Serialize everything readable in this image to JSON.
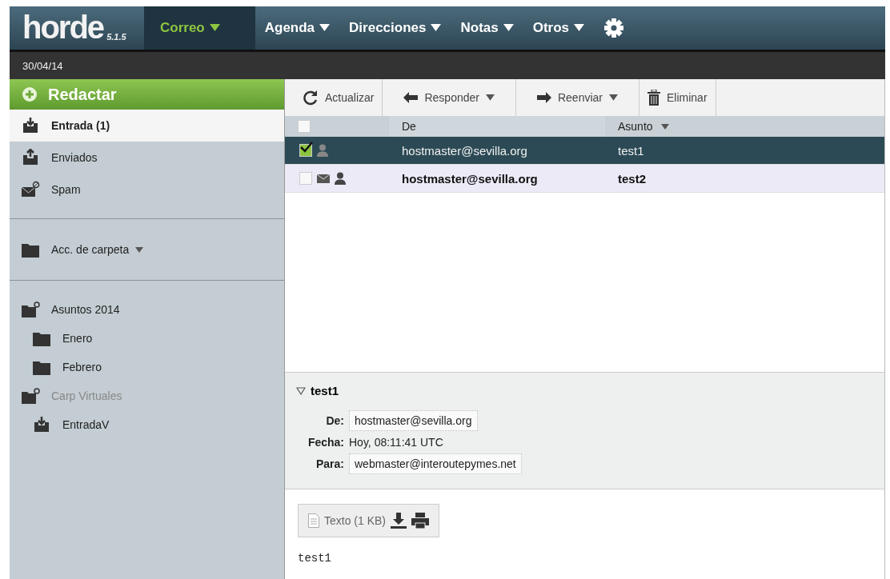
{
  "app": {
    "logo": "horde",
    "version": "5.1.5"
  },
  "menu": [
    {
      "label": "Correo",
      "selected": true
    },
    {
      "label": "Agenda",
      "selected": false
    },
    {
      "label": "Direcciones",
      "selected": false
    },
    {
      "label": "Notas",
      "selected": false
    },
    {
      "label": "Otros",
      "selected": false
    }
  ],
  "date": "30/04/14",
  "compose": "Redactar",
  "sidebar": {
    "mailboxes": [
      {
        "kind": "inbox",
        "label": "Entrada (1)",
        "selected": true
      },
      {
        "kind": "sent",
        "label": "Enviados",
        "selected": false
      },
      {
        "kind": "spam",
        "label": "Spam",
        "selected": false
      }
    ],
    "folder_actions": "Acc. de carpeta",
    "folders": [
      {
        "kind": "container",
        "label": "Asuntos 2014",
        "disabled": false,
        "selected": false,
        "children": [
          {
            "kind": "folder",
            "label": "Enero",
            "disabled": false,
            "selected": false
          },
          {
            "kind": "folder",
            "label": "Febrero",
            "disabled": false,
            "selected": false
          }
        ]
      },
      {
        "kind": "container",
        "label": "Carp Virtuales",
        "disabled": true,
        "selected": false,
        "children": [
          {
            "kind": "inbox",
            "label": "EntradaV",
            "disabled": false,
            "selected": false
          }
        ]
      }
    ]
  },
  "toolbar": [
    {
      "kind": "refresh",
      "label": "Actualizar",
      "dropdown": false
    },
    {
      "kind": "reply",
      "label": "Responder",
      "dropdown": true
    },
    {
      "kind": "forward",
      "label": "Reenviar",
      "dropdown": true
    },
    {
      "kind": "delete",
      "label": "Eliminar",
      "dropdown": false
    }
  ],
  "table": {
    "all_checked": false,
    "columns": [
      "De",
      "Asunto"
    ],
    "rows": [
      {
        "from": "hostmaster@sevilla.org",
        "subject": "test1",
        "checked": true,
        "selected": true,
        "unread": false
      },
      {
        "from": "hostmaster@sevilla.org",
        "subject": "test2",
        "checked": false,
        "selected": false,
        "unread": true
      }
    ]
  },
  "preview": {
    "subject": "test1",
    "expanded": true,
    "headers": [
      {
        "kind": "address",
        "label": "De:",
        "value": "hostmaster@sevilla.org"
      },
      {
        "kind": "text",
        "label": "Fecha:",
        "value": "Hoy, 08:11:41 UTC"
      },
      {
        "kind": "address",
        "label": "Para:",
        "value": "webmaster@interoutepymes.net"
      }
    ],
    "attachment": "Texto (1 KB)",
    "body": "test1"
  }
}
